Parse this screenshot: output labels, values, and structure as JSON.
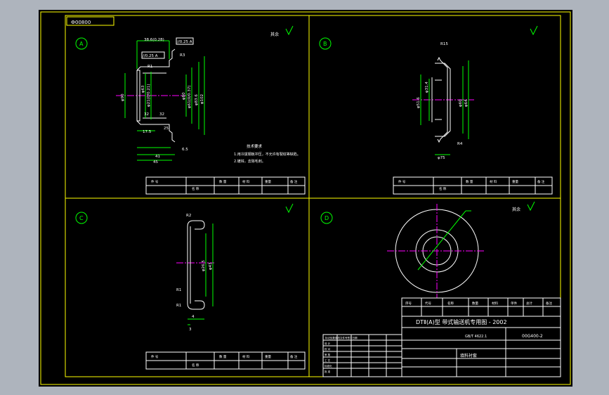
{
  "canvas": {
    "background": "#000000",
    "border_color": "#ffff00",
    "dim_color": "#ff00ff",
    "line_color": "#ffffff",
    "center_color": "#ff00ff",
    "accent_green": "#00ff00"
  },
  "top_tag": "Ф00800",
  "views": [
    {
      "label": "A",
      "roughness": "其余"
    },
    {
      "label": "B",
      "roughness": ""
    },
    {
      "label": "C",
      "roughness": ""
    },
    {
      "label": "D",
      "roughness": "其余"
    }
  ],
  "view_a": {
    "dims": [
      "38.6(0.28)",
      "//0.25 A",
      "//0.25 A",
      "R3",
      "R1",
      "φ90",
      "φ63",
      "φ21(0/0.21)",
      "φ80",
      "φ61(0/0.37)",
      "φ83.6",
      "φ102",
      "32",
      "32",
      "17.5",
      "25",
      "41",
      "45",
      "6.5"
    ],
    "notes": [
      "技术要求",
      "1.用冷拔钢板冲压，不允许有裂纹等缺陷。",
      "2.镀锌，去除毛刺。"
    ]
  },
  "view_b": {
    "dims": [
      "R15",
      "φ51.6",
      "φ31.4",
      "φ60",
      "φ64",
      "R4",
      "φ75"
    ]
  },
  "view_c": {
    "dims": [
      "R2",
      "φ26.5",
      "φ43",
      "R1",
      "R1",
      "4",
      "3"
    ]
  },
  "view_d": {
    "dims": []
  },
  "mini_tables": [
    {
      "cols": [
        "件 号",
        "名 称",
        "数 量",
        "材 料",
        "重量",
        "备 注"
      ]
    },
    {
      "cols": [
        "件 号",
        "名 称",
        "数 量",
        "材 料",
        "重量",
        "备 注"
      ]
    },
    {
      "cols": [
        "件 号",
        "名 称",
        "数 量",
        "材 料",
        "重量",
        "备 注"
      ]
    }
  ],
  "title_block": {
    "series": "DTⅡ(A)型 带式输送机专用图 - 2002",
    "part_no": "00G400-2",
    "standard": "GB/T 4622.1",
    "name": "填料衬套",
    "header": [
      "序号",
      "代号",
      "名称",
      "数量",
      "材料",
      "单件",
      "总计",
      "备注"
    ]
  },
  "change_block": {
    "title": "标记处数更改文件号签字日期",
    "rows": [
      "设 计",
      "校 对",
      "审 核",
      "工 艺",
      "标准化",
      "批 准"
    ]
  }
}
